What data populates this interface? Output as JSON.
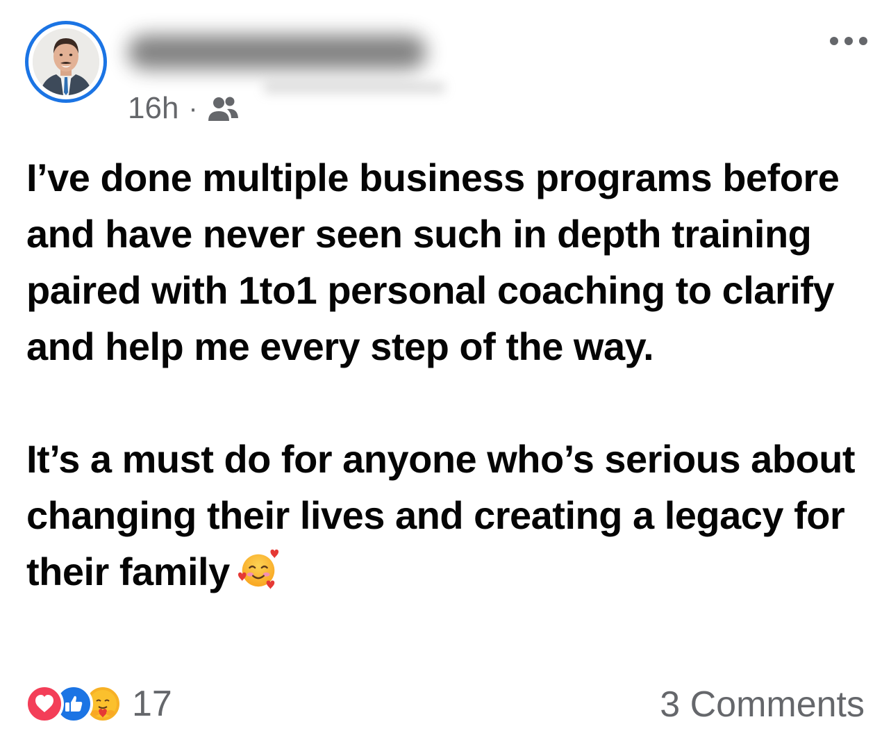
{
  "post": {
    "author_name": "",
    "timestamp": "16h",
    "separator": "·",
    "audience_icon": "friends-icon",
    "menu_icon": "more-icon",
    "paragraphs": [
      "I’ve done multiple business programs before and have never seen such in depth training paired with 1to1 personal coaching to clarify and help me every step of the way.",
      "It’s a must do for anyone who’s serious about changing their lives and creating a legacy for their family"
    ],
    "trailing_emoji": "smiling-face-with-hearts"
  },
  "footer": {
    "reaction_icons": [
      "love-icon",
      "like-icon",
      "care-icon"
    ],
    "reaction_count": "17",
    "comments_label": "3 Comments"
  },
  "colors": {
    "accent": "#1b74e4",
    "text": "#050505",
    "secondary_text": "#65676b",
    "love": "#f33e58",
    "like": "#1b74e4",
    "care": "#f7b125"
  }
}
